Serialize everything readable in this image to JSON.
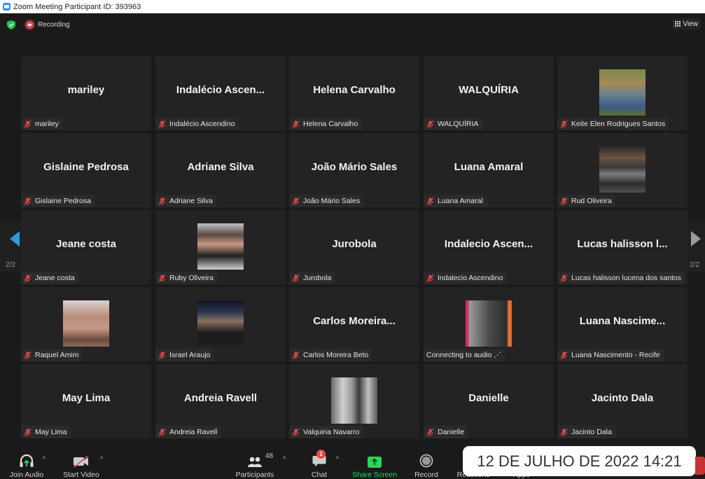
{
  "window": {
    "title": "Zoom Meeting Participant ID: 393963"
  },
  "topbar": {
    "recording_label": "Recording",
    "view_label": "View"
  },
  "pagination": {
    "left": "2/2",
    "right": "2/2"
  },
  "participants": [
    {
      "display": "mariley",
      "name": "mariley",
      "photo": null
    },
    {
      "display": "Indalécio  Ascen...",
      "name": "Indalécio Ascendino",
      "photo": null
    },
    {
      "display": "Helena Carvalho",
      "name": "Helena Carvalho",
      "photo": null
    },
    {
      "display": "WALQUÍRIA",
      "name": "WALQUÍRIA",
      "photo": null
    },
    {
      "display": "",
      "name": "Keite Elen Rodrigues Santos",
      "photo": "woman-curly-hair-outdoors"
    },
    {
      "display": "Gislaine Pedrosa",
      "name": "Gislaine Pedrosa",
      "photo": null
    },
    {
      "display": "Adriane Silva",
      "name": "Adriane Silva",
      "photo": null
    },
    {
      "display": "João Mário Sales",
      "name": "João Mário Sales",
      "photo": null
    },
    {
      "display": "Luana Amaral",
      "name": "Luana Amaral",
      "photo": null
    },
    {
      "display": "",
      "name": "Rud Oliveira",
      "photo": "man-floral-shirt"
    },
    {
      "display": "Jeane costa",
      "name": "Jeane costa",
      "photo": null
    },
    {
      "display": "",
      "name": "Ruby Oliveira",
      "photo": "person-selfie"
    },
    {
      "display": "Jurobola",
      "name": "Jurobola",
      "photo": null
    },
    {
      "display": "Indalecio  Ascen...",
      "name": "Indalecio Ascendino",
      "photo": null
    },
    {
      "display": "Lucas  halisson  l...",
      "name": "Lucas halisson lucena dos santos",
      "photo": null
    },
    {
      "display": "",
      "name": "Raquel Amim",
      "photo": "woman-selfie"
    },
    {
      "display": "",
      "name": "Israel Araujo",
      "photo": "group-night"
    },
    {
      "display": "Carlos  Moreira...",
      "name": "Carlos Moreira Beto",
      "photo": null
    },
    {
      "display": "",
      "name": "Connecting to audio ⋰",
      "photo": "woman-bw-portrait",
      "connecting": true
    },
    {
      "display": "Luana  Nascime...",
      "name": "Luana Nascimento - Recife",
      "photo": null
    },
    {
      "display": "May Lima",
      "name": "May Lima",
      "photo": null
    },
    {
      "display": "Andreia Ravell",
      "name": "Andreia Ravell",
      "photo": null
    },
    {
      "display": "",
      "name": "Valquiria Navarro",
      "photo": "woman-bw-street"
    },
    {
      "display": "Danielle",
      "name": "Danielle",
      "photo": null
    },
    {
      "display": "Jacinto Dala",
      "name": "Jacinto Dala",
      "photo": null
    }
  ],
  "toolbar": {
    "join_audio": "Join Audio",
    "start_video": "Start Video",
    "participants": "Participants",
    "participant_count": "48",
    "chat": "Chat",
    "chat_badge": "1",
    "share_screen": "Share Screen",
    "record": "Record",
    "reactions": "Reactions",
    "apps": "Apps"
  },
  "overlay": {
    "datetime": "12 DE JULHO DE 2022 14:21"
  },
  "colors": {
    "accent_blue": "#2b9be0",
    "share_green": "#23d959",
    "muted_red": "#e5484d"
  }
}
